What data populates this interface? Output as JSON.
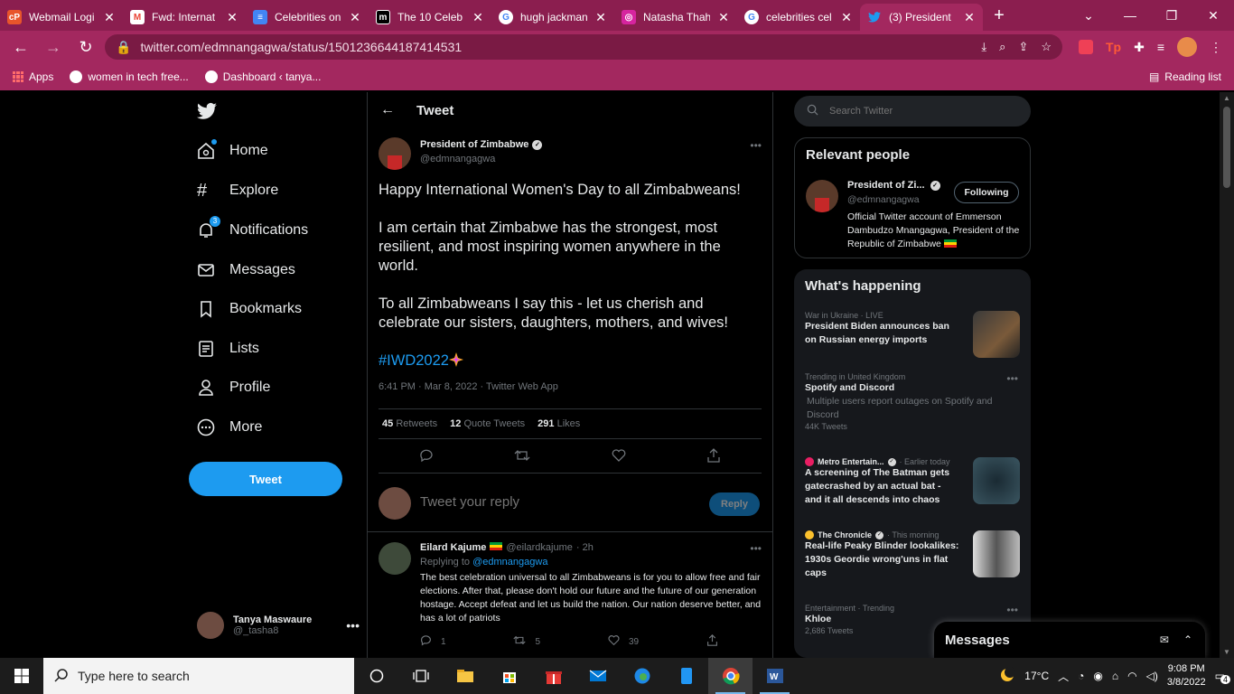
{
  "browser": {
    "tabs": [
      {
        "title": "Webmail Logi",
        "fav_color": "#e8552b",
        "fav_text": "cP"
      },
      {
        "title": "Fwd: Internat",
        "fav_color": "#ea4335",
        "fav_text": "M"
      },
      {
        "title": "Celebrities on",
        "fav_color": "#4285f4",
        "fav_text": "≡"
      },
      {
        "title": "The 10 Celeb",
        "fav_color": "#000000",
        "fav_text": "m"
      },
      {
        "title": "hugh jackman",
        "fav_color": "#ffffff",
        "fav_text": "G"
      },
      {
        "title": "Natasha Thah",
        "fav_color": "#d6249f",
        "fav_text": "◎"
      },
      {
        "title": "celebrities cel",
        "fav_color": "#ffffff",
        "fav_text": "G"
      },
      {
        "title": "(3) President",
        "fav_color": "#1d9bf0",
        "fav_text": "t",
        "active": true
      }
    ],
    "url": "twitter.com/edmnangagwa/status/1501236644187414531",
    "bookmarks": [
      {
        "label": "Apps"
      },
      {
        "label": "women in tech free..."
      },
      {
        "label": "Dashboard ‹ tanya..."
      }
    ],
    "reading_list": "Reading list",
    "ext_tp": "Tp"
  },
  "nav": {
    "items": [
      {
        "label": "Home"
      },
      {
        "label": "Explore"
      },
      {
        "label": "Notifications",
        "badge": "3"
      },
      {
        "label": "Messages"
      },
      {
        "label": "Bookmarks"
      },
      {
        "label": "Lists"
      },
      {
        "label": "Profile"
      },
      {
        "label": "More"
      }
    ],
    "tweet_button": "Tweet",
    "account": {
      "name": "Tanya Maswaure",
      "handle": "@_tasha8"
    }
  },
  "main": {
    "title": "Tweet",
    "tweet": {
      "name": "President of Zimbabwe",
      "handle": "@edmnangagwa",
      "paragraphs": [
        "Happy International Women's Day to all Zimbabweans!",
        "I am certain that Zimbabwe has the strongest, most resilient, and most inspiring women anywhere in the world.",
        "To all Zimbabweans I say this - let us cherish and celebrate our sisters, daughters, mothers, and wives!"
      ],
      "hashtag": "#IWD2022",
      "meta": "6:41 PM · Mar 8, 2022 · Twitter Web App",
      "retweets_count": "45",
      "retweets_label": "Retweets",
      "quotes_count": "12",
      "quotes_label": "Quote Tweets",
      "likes_count": "291",
      "likes_label": "Likes"
    },
    "reply_placeholder": "Tweet your reply",
    "reply_button": "Reply",
    "comment": {
      "name": "Eilard Kajume",
      "handle": "@eilardkajume",
      "time": "· 2h",
      "replying_prefix": "Replying to",
      "replying_to": "@edmnangagwa",
      "text": "The best celebration universal to all Zimbabweans is for you to allow free and fair elections. After that, please don't hold our future and the future of our generation hostage. Accept defeat and let us build the nation. Our nation deserve better, and has a lot of patriots",
      "replies": "1",
      "retweets": "5",
      "likes": "39"
    }
  },
  "sidebar": {
    "search_placeholder": "Search Twitter",
    "relevant": {
      "title": "Relevant people",
      "name": "President of Zi...",
      "handle": "@edmnangagwa",
      "follow_label": "Following",
      "bio": "Official Twitter account of Emmerson Dambudzo Mnangagwa, President of the Republic of Zimbabwe"
    },
    "happening": {
      "title": "What's happening",
      "trends": [
        {
          "meta": "War in Ukraine · LIVE",
          "headline": "President Biden announces ban on Russian energy imports"
        },
        {
          "meta": "Trending in United Kingdom",
          "headline": "Spotify and Discord",
          "sub": "Multiple users report outages on Spotify and Discord",
          "count": "44K Tweets"
        },
        {
          "source": "Metro Entertain...",
          "when": "· Earlier today",
          "headline": "A screening of The Batman gets gatecrashed by an actual bat - and it all descends into chaos"
        },
        {
          "source": "The Chronicle",
          "when": "· This morning",
          "headline": "Real-life Peaky Blinder lookalikes: 1930s Geordie wrong'uns in flat caps"
        },
        {
          "meta": "Entertainment · Trending",
          "headline": "Khloe",
          "count": "2,686 Tweets"
        }
      ]
    },
    "messages_drawer": "Messages"
  },
  "taskbar": {
    "search_placeholder": "Type here to search",
    "temperature": "17°C",
    "time": "9:08 PM",
    "date": "3/8/2022",
    "notification_count": "4"
  }
}
